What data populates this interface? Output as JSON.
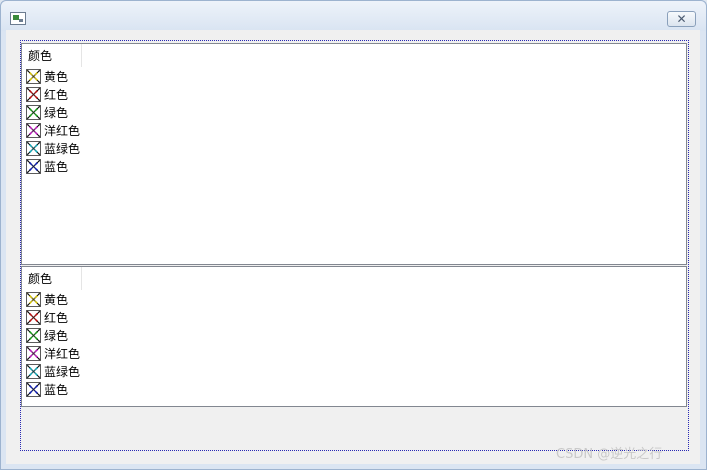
{
  "window": {
    "close_symbol": "✕"
  },
  "tree_top": {
    "header": "颜色",
    "items": [
      {
        "label": "黄色",
        "color": "#e8d400"
      },
      {
        "label": "红色",
        "color": "#d01010"
      },
      {
        "label": "绿色",
        "color": "#18b018"
      },
      {
        "label": "洋红色",
        "color": "#d018d0"
      },
      {
        "label": "蓝绿色",
        "color": "#10b8c8"
      },
      {
        "label": "蓝色",
        "color": "#1020c8"
      }
    ]
  },
  "tree_bottom": {
    "header": "颜色",
    "items": [
      {
        "label": "黄色",
        "color": "#e8d400"
      },
      {
        "label": "红色",
        "color": "#d01010"
      },
      {
        "label": "绿色",
        "color": "#18b018"
      },
      {
        "label": "洋红色",
        "color": "#d018d0"
      },
      {
        "label": "蓝绿色",
        "color": "#10b8c8"
      },
      {
        "label": "蓝色",
        "color": "#1020c8"
      }
    ]
  },
  "watermark": "CSDN @逆光之行",
  "icon_name": "color-flower-icon"
}
